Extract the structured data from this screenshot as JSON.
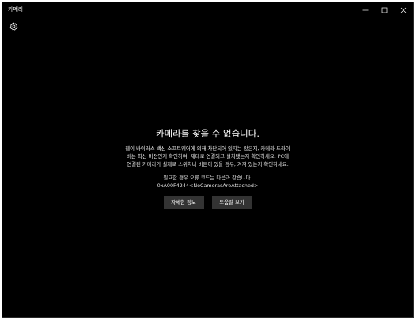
{
  "window": {
    "title": "카메라"
  },
  "titlebar": {
    "minimize_icon": "minimize-icon",
    "maximize_icon": "maximize-icon",
    "close_icon": "close-icon"
  },
  "toolbar": {
    "settings_icon": "gear-icon"
  },
  "error": {
    "headline": "카메라를 찾을 수 없습니다.",
    "body_lines": [
      "웹이 바이러스 백신 소프트웨어에 의해 차단되어 있지는 않은지, 카메라 드라이",
      "버는 최신 버전인지 확인하여, 제대로 연결되고 설치됐는지 확인하세요. PC에",
      "연결된 카메라가 실제로 스위치나 버튼이 있을 경우, 켜져 있는지 확인하세요."
    ],
    "code_intro": "필요한 경우 오류 코드는 다음과 같습니다.",
    "error_code": "0xA00F4244<NoCamerasAreAttached>"
  },
  "actions": {
    "details_label": "자세한 정보",
    "help_label": "도움말 보기"
  },
  "colors": {
    "background": "#000000",
    "button": "#333333",
    "text": "#ffffff"
  }
}
